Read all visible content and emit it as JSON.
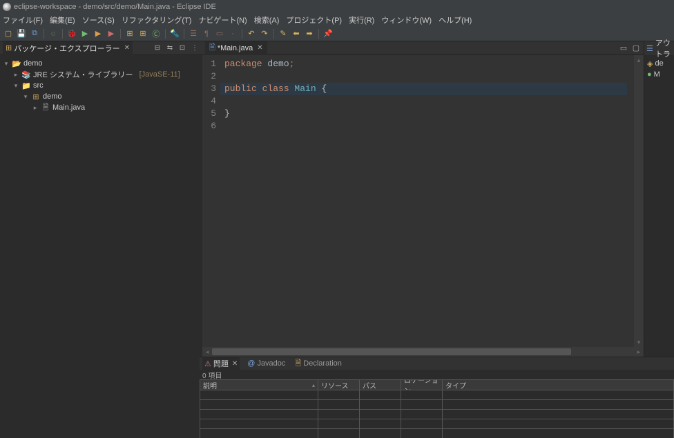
{
  "title": "eclipse-workspace - demo/src/demo/Main.java - Eclipse IDE",
  "menubar": [
    "ファイル(F)",
    "編集(E)",
    "ソース(S)",
    "リファクタリング(T)",
    "ナビゲート(N)",
    "検索(A)",
    "プロジェクト(P)",
    "実行(R)",
    "ウィンドウ(W)",
    "ヘルプ(H)"
  ],
  "package_explorer": {
    "title": "パッケージ・エクスプローラー",
    "project": "demo",
    "jre": "JRE システム・ライブラリー",
    "jre_ver": "[JavaSE-11]",
    "src": "src",
    "pkg": "demo",
    "file": "Main.java"
  },
  "editor": {
    "tab_title": "*Main.java",
    "line_numbers": [
      "1",
      "2",
      "3",
      "4",
      "5",
      "6"
    ],
    "code": {
      "l1_kw": "package",
      "l1_id": " demo",
      "l1_p": ";",
      "l3_pub": "public",
      "l3_cls": " class",
      "l3_type": " Main",
      "l3_sp": " ",
      "l3_br": "{",
      "l5": "}"
    }
  },
  "outline": {
    "title": "アウトラ",
    "rows": [
      {
        "icon": "◈",
        "label": "de"
      },
      {
        "icon": "●",
        "label": "M"
      }
    ]
  },
  "problems": {
    "tabs": [
      "問題",
      "Javadoc",
      "Declaration"
    ],
    "count": "0 項目",
    "columns": [
      "説明",
      "リソース",
      "パス",
      "ロケーション",
      "タイプ"
    ]
  }
}
